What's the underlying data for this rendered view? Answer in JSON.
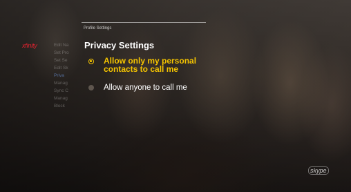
{
  "header": {
    "breadcrumb": "Profile Settings"
  },
  "brand": {
    "logo_text": "xfinity",
    "logo_color": "#e0232f"
  },
  "sidebar": {
    "items": [
      {
        "label": "Edit Na"
      },
      {
        "label": "Set Pro"
      },
      {
        "label": "Set Se"
      },
      {
        "label": "Edit Sk"
      },
      {
        "label": "Priva"
      },
      {
        "label": "Manag"
      },
      {
        "label": "Sync C"
      },
      {
        "label": "Manag"
      },
      {
        "label": "Block"
      }
    ]
  },
  "main": {
    "title": "Privacy Settings",
    "options": [
      {
        "label": "Allow only my personal contacts to call me",
        "selected": true
      },
      {
        "label": "Allow anyone to call me",
        "selected": false
      }
    ]
  },
  "footer": {
    "skype_logo": "skype"
  },
  "colors": {
    "accent": "#f5c400",
    "text": "#ffffff"
  }
}
